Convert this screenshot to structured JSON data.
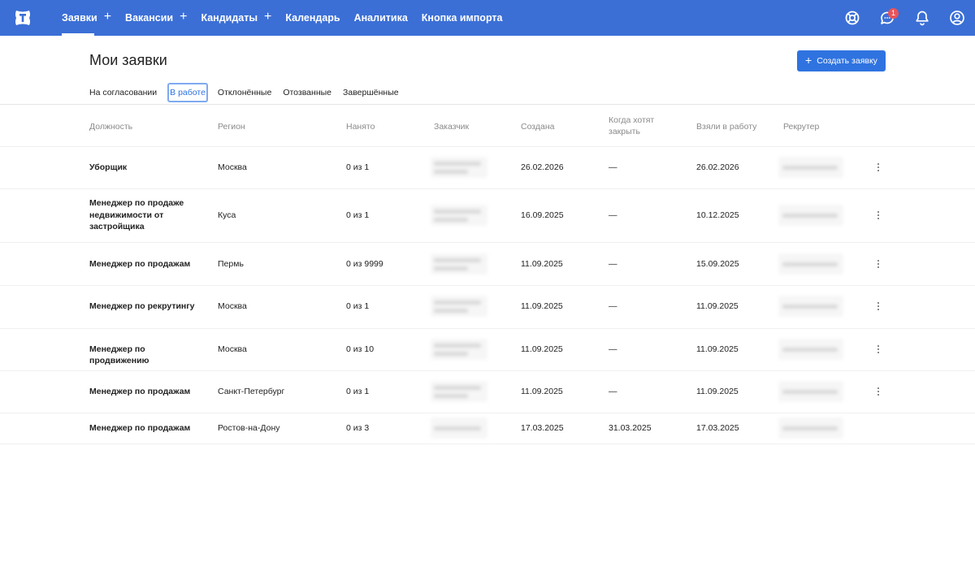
{
  "nav": {
    "items": [
      {
        "label": "Заявки",
        "plus": "+"
      },
      {
        "label": "Вакансии",
        "plus": "+"
      },
      {
        "label": "Кандидаты",
        "plus": "+"
      },
      {
        "label": "Календарь",
        "plus": ""
      },
      {
        "label": "Аналитика",
        "plus": ""
      },
      {
        "label": "Кнопка импорта",
        "plus": ""
      }
    ],
    "notification_count": "1"
  },
  "page": {
    "title": "Мои заявки",
    "create_button": "Создать заявку",
    "create_plus": "+"
  },
  "tabs": [
    "На согласовании",
    "В работе",
    "Отклонённые",
    "Отозванные",
    "Завершённые"
  ],
  "table": {
    "headers": {
      "position": "Должность",
      "region": "Регион",
      "hired": "Нанято",
      "customer": "Заказчик",
      "created": "Создана",
      "close_line1": "Когда хотят",
      "close_line2": "закрыть",
      "taken": "Взяли в работу",
      "recruiter": "Рекрутер"
    },
    "rows": [
      {
        "position": "Уборщик",
        "region": "Москва",
        "hired": "0 из 1",
        "created": "26.02.2026",
        "close": "—",
        "taken": "26.02.2026"
      },
      {
        "position": "Менеджер по продаже недвижимости от застройщика",
        "region": "Куса",
        "hired": "0 из 1",
        "created": "16.09.2025",
        "close": "—",
        "taken": "10.12.2025"
      },
      {
        "position": "Менеджер по продажам",
        "region": "Пермь",
        "hired": "0 из 9999",
        "created": "11.09.2025",
        "close": "—",
        "taken": "15.09.2025"
      },
      {
        "position": "Менеджер по рекрутингу",
        "region": "Москва",
        "hired": "0 из 1",
        "created": "11.09.2025",
        "close": "—",
        "taken": "11.09.2025"
      },
      {
        "position": "Менеджер по продвижению",
        "region": "Москва",
        "hired": "0 из 10",
        "created": "11.09.2025",
        "close": "—",
        "taken": "11.09.2025"
      },
      {
        "position": "Менеджер по продажам",
        "region": "Санкт-Петербург",
        "hired": "0 из 1",
        "created": "11.09.2025",
        "close": "—",
        "taken": "11.09.2025"
      },
      {
        "position": "Менеджер по продажам",
        "region": "Ростов-на-Дону",
        "hired": "0 из 3",
        "created": "17.03.2025",
        "close": "31.03.2025",
        "taken": "17.03.2025"
      }
    ]
  },
  "colors": {
    "topbar": "#3b6fd6",
    "accent": "#2f73e0",
    "badge": "#e9545a"
  }
}
